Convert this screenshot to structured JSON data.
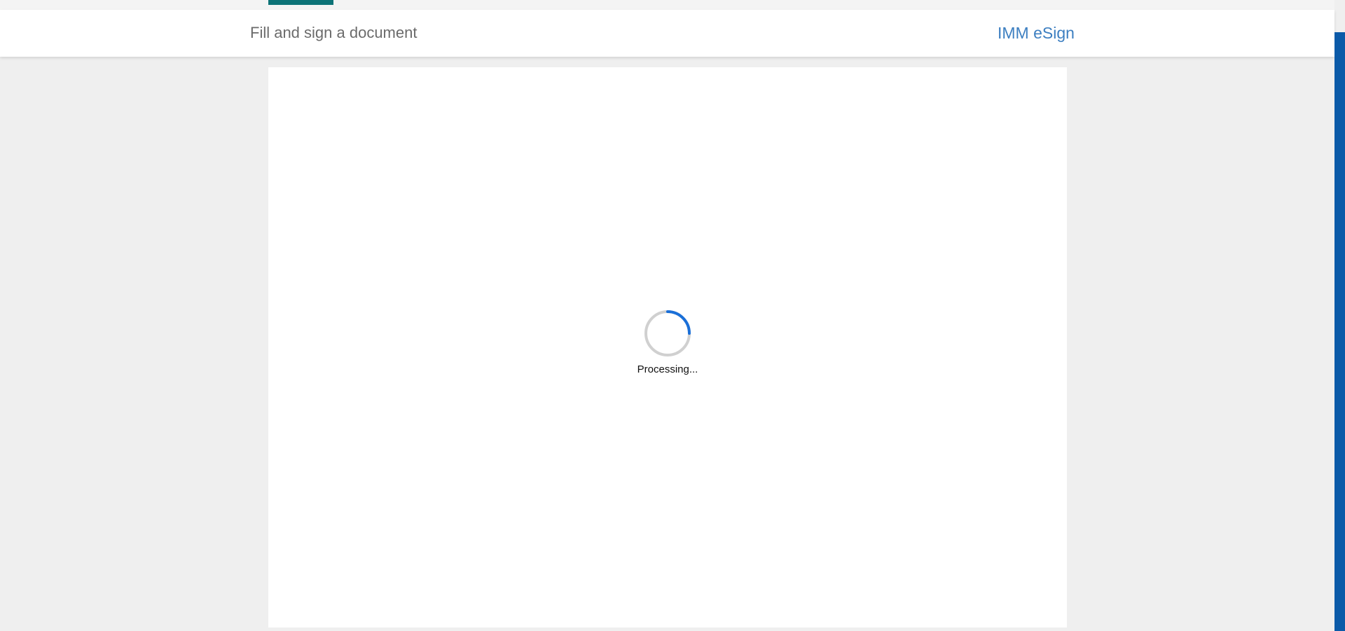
{
  "header": {
    "title": "Fill and sign a document",
    "brand": "IMM eSign"
  },
  "loader": {
    "label": "Processing...",
    "spinner_icon": "loading-spinner-icon"
  },
  "colors": {
    "accent_teal": "#0d7377",
    "brand_blue": "#3d7fc1",
    "side_bar_blue": "#0b5aa8",
    "spinner_blue": "#1a6fd8",
    "spinner_track": "#d0d0d0",
    "background": "#efefef"
  }
}
